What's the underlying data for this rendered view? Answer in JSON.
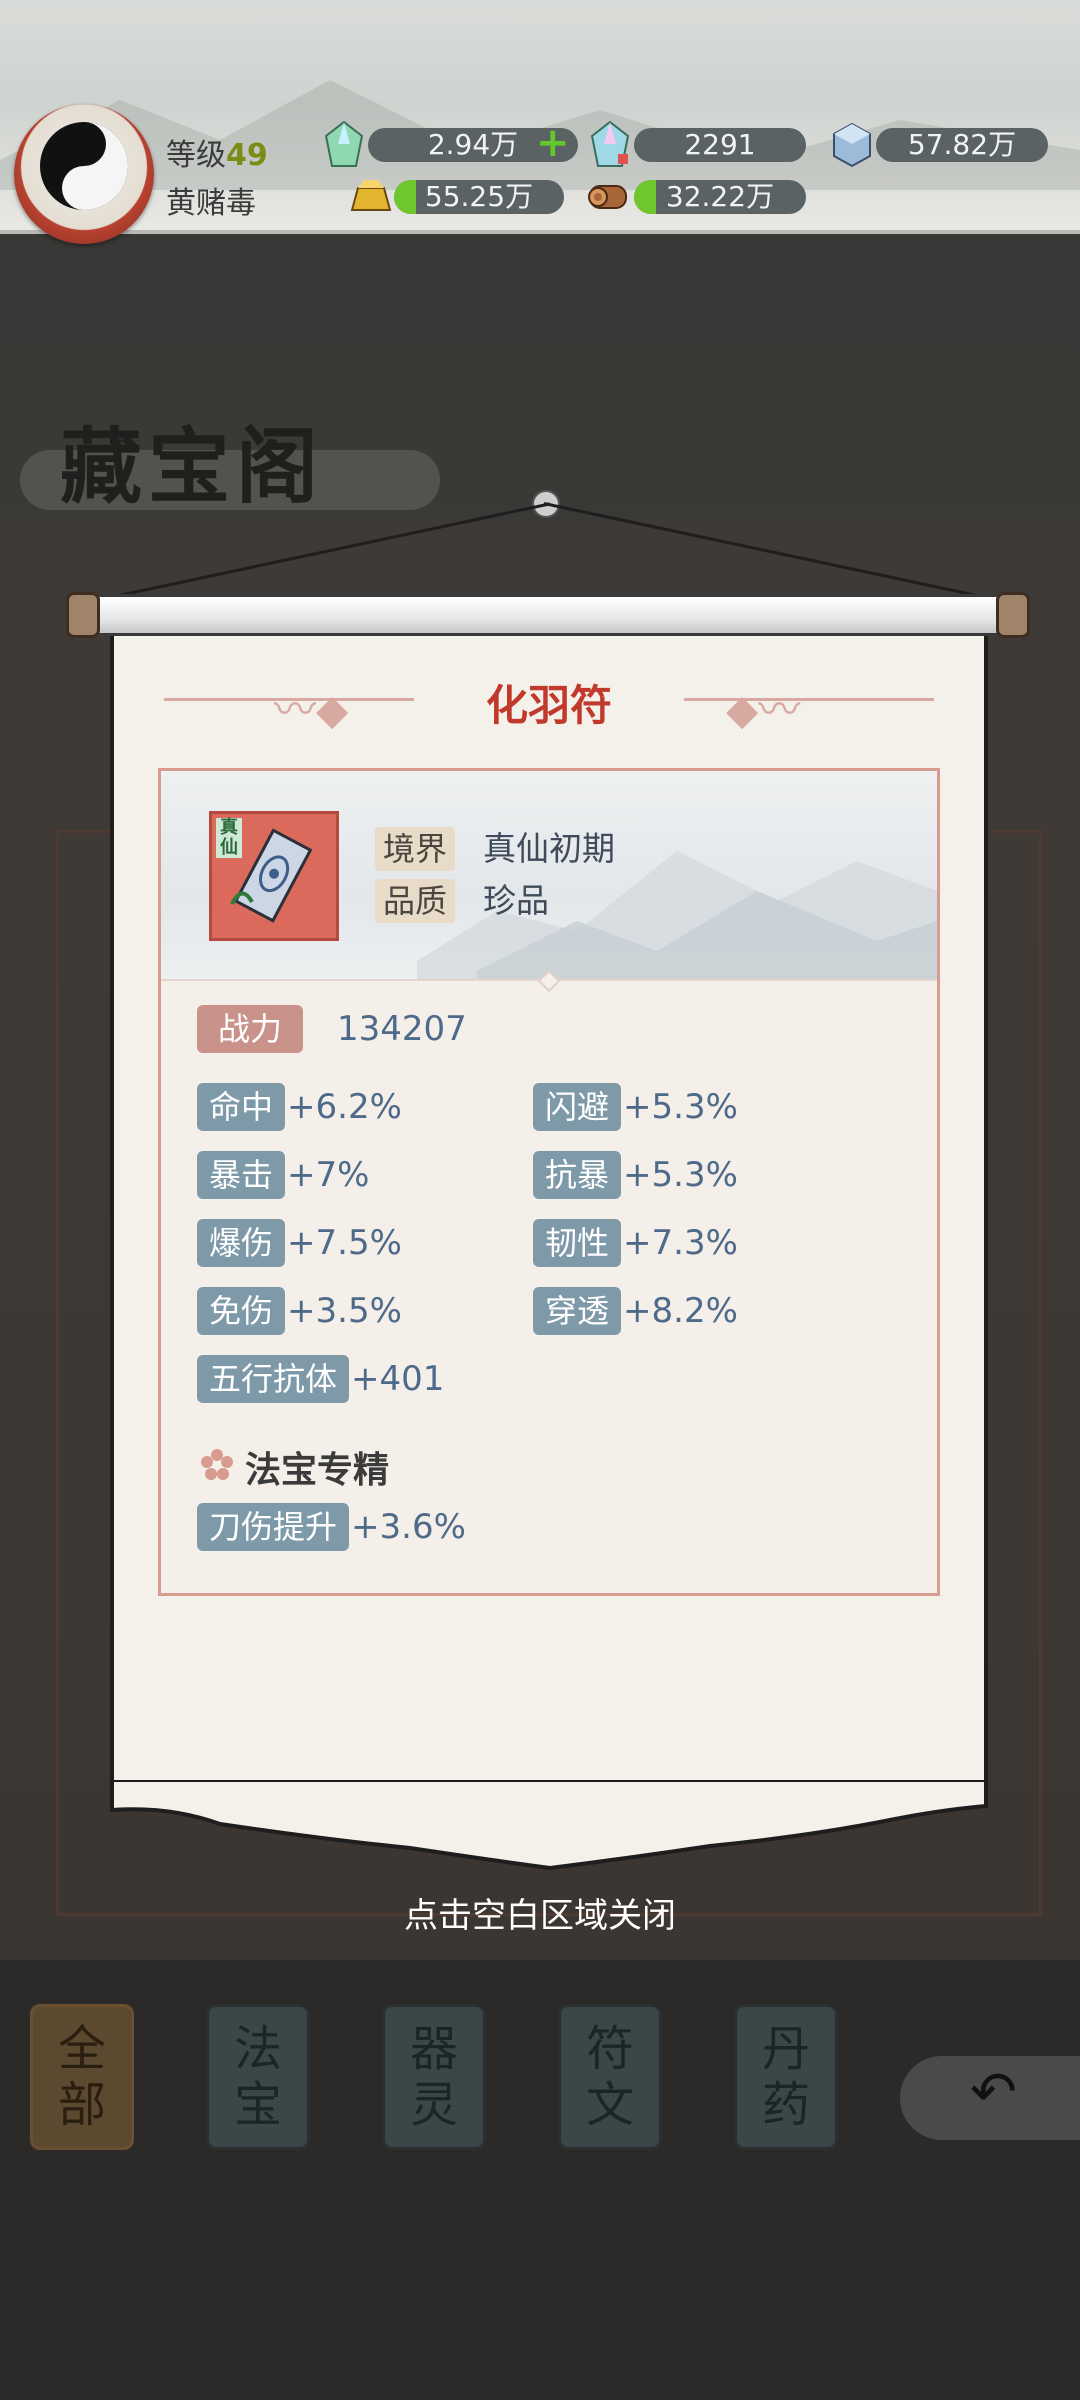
{
  "header": {
    "level_label": "等级",
    "level_value": "49",
    "player_name": "黄赌毒",
    "resources": [
      {
        "name": "spirit-stone",
        "value": "2.94万"
      },
      {
        "name": "bound-spirit-stone",
        "value": "2291"
      },
      {
        "name": "crystal",
        "value": "57.82万"
      },
      {
        "name": "gold-ingot",
        "value": "55.25万"
      },
      {
        "name": "wood",
        "value": "32.22万"
      }
    ]
  },
  "scene": {
    "title": "藏宝阁",
    "tabs": [
      {
        "label": "全部",
        "active": true
      },
      {
        "label": "法宝",
        "active": false
      },
      {
        "label": "器灵",
        "active": false
      },
      {
        "label": "符文",
        "active": false
      },
      {
        "label": "丹药",
        "active": false
      }
    ]
  },
  "popup": {
    "item_name": "化羽符",
    "realm_tag": "真仙",
    "realm_label": "境界",
    "realm_value": "真仙初期",
    "quality_label": "品质",
    "quality_value": "珍品",
    "power_label": "战力",
    "power_value": "134207",
    "stats": [
      {
        "label": "命中",
        "value": "+6.2%"
      },
      {
        "label": "闪避",
        "value": "+5.3%"
      },
      {
        "label": "暴击",
        "value": "+7%"
      },
      {
        "label": "抗暴",
        "value": "+5.3%"
      },
      {
        "label": "爆伤",
        "value": "+7.5%"
      },
      {
        "label": "韧性",
        "value": "+7.3%"
      },
      {
        "label": "免伤",
        "value": "+3.5%"
      },
      {
        "label": "穿透",
        "value": "+8.2%"
      },
      {
        "label": "五行抗体",
        "value": "+401"
      }
    ],
    "specialty_title": "法宝专精",
    "specialty_stat": {
      "label": "刀伤提升",
      "value": "+3.6%"
    }
  },
  "close_hint": "点击空白区域关闭",
  "colors": {
    "title_red": "#c0392b",
    "stat_label_bg": "#7e9aa9",
    "power_label_bg": "#c9928a",
    "value_blue": "#4e6a8a",
    "resource_fill_green": "#6fc72d"
  }
}
